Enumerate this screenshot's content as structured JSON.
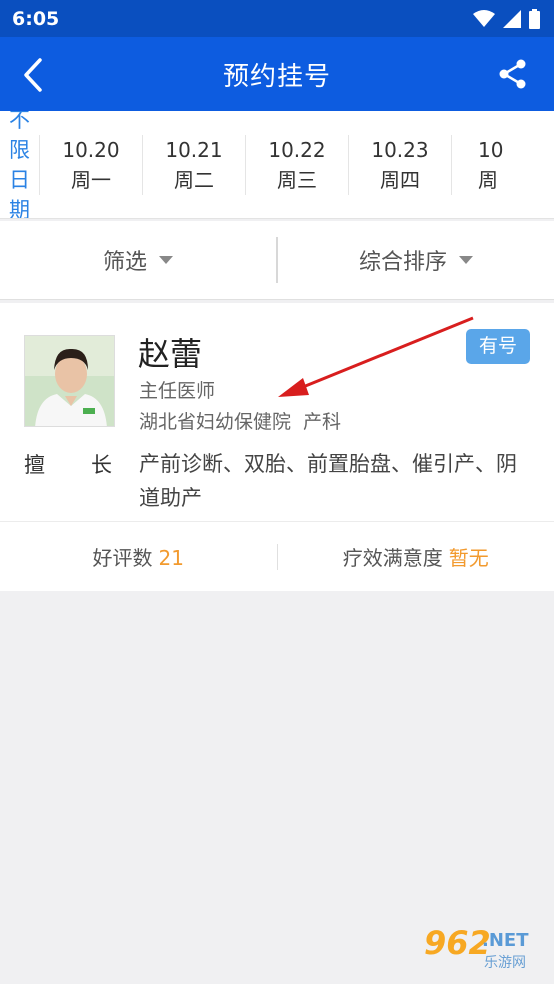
{
  "status_bar": {
    "time": "6:05"
  },
  "header": {
    "title": "预约挂号"
  },
  "dates": {
    "unlimited": [
      "不限",
      "日期"
    ],
    "items": [
      {
        "date": "10.20",
        "weekday": "周一"
      },
      {
        "date": "10.21",
        "weekday": "周二"
      },
      {
        "date": "10.22",
        "weekday": "周三"
      },
      {
        "date": "10.23",
        "weekday": "周四"
      },
      {
        "date": "10",
        "weekday": "周"
      }
    ]
  },
  "filters": {
    "filter_label": "筛选",
    "sort_label": "综合排序"
  },
  "doctor": {
    "name": "赵蕾",
    "badge": "有号",
    "rank": "主任医师",
    "hospital": "湖北省妇幼保健院",
    "department": "产科",
    "specialty_label": "擅长",
    "specialty_text": "产前诊断、双胎、前置胎盘、催引产、阴道助产",
    "rating_label": "好评数",
    "rating_value": "21",
    "satisfaction_label": "疗效满意度",
    "satisfaction_value": "暂无"
  },
  "watermark": {
    "number": "962",
    "net": ".NET",
    "sub": "乐游网"
  },
  "colors": {
    "header_bg": "#0d5ce0",
    "accent": "#2a82e4",
    "badge": "#5aa6e9",
    "highlight": "#f29a2e"
  }
}
